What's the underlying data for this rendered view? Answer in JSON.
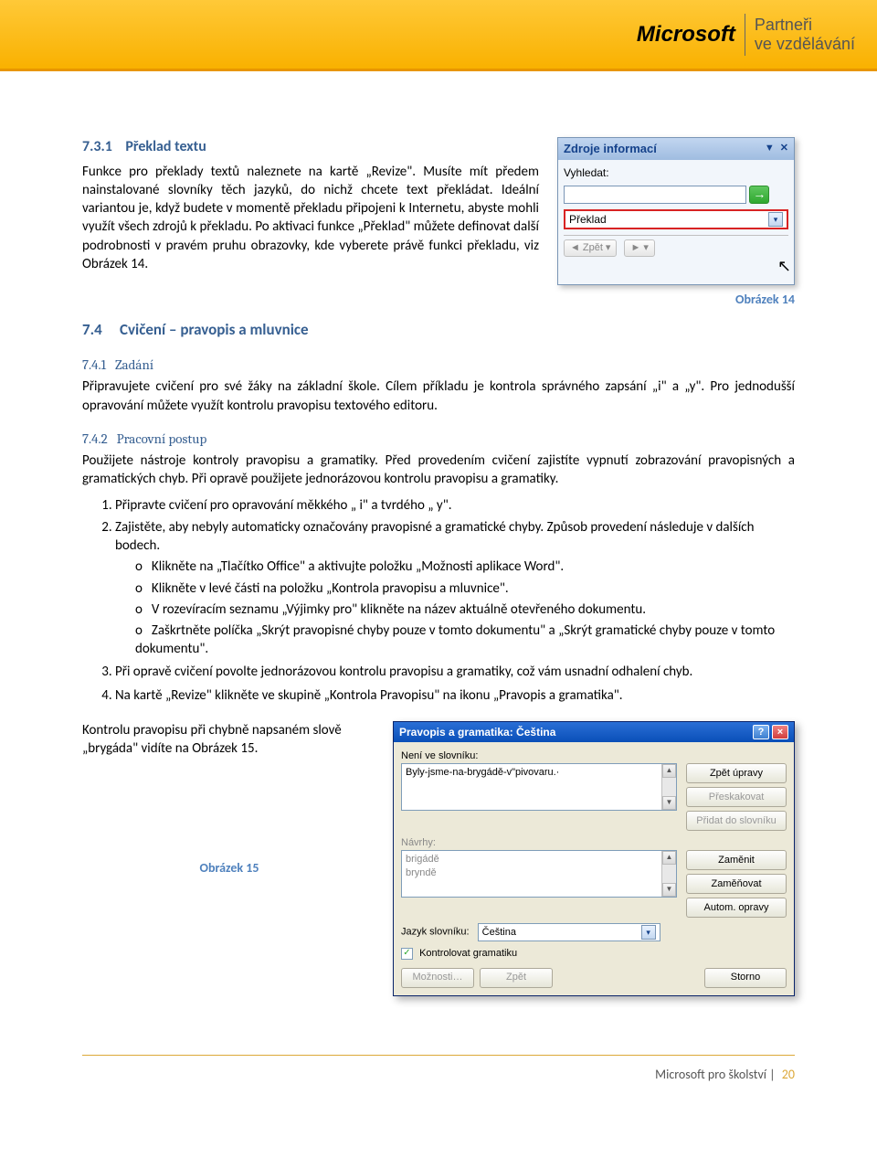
{
  "header": {
    "logo": "Microsoft",
    "partner_line1": "Partneři",
    "partner_line2": "ve vzdělávání"
  },
  "s731": {
    "number": "7.3.1",
    "title": "Překlad textu",
    "para": "Funkce pro překlady textů naleznete na kartě „Revize\". Musíte mít předem nainstalované slovníky těch jazyků, do nichž chcete text překládat. Ideální variantou je, když budete v momentě překladu připojeni k Internetu, abyste mohli využít všech zdrojů k překladu. Po aktivaci funkce „Překlad\" můžete definovat další podrobnosti v pravém pruhu obrazovky, kde vyberete právě funkci překladu, viz Obrázek 14."
  },
  "pane": {
    "title": "Zdroje informací",
    "search_label": "Vyhledat:",
    "select_value": "Překlad",
    "back": "Zpět"
  },
  "caption14": "Obrázek 14",
  "s74": {
    "number": "7.4",
    "title": "Cvičení – pravopis a mluvnice"
  },
  "s741": {
    "number": "7.4.1",
    "title": "Zadání",
    "para": "Připravujete cvičení pro své žáky na základní škole. Cílem příkladu je kontrola správného zapsání „i\" a „y\". Pro jednodušší opravování můžete využít kontrolu pravopisu textového editoru."
  },
  "s742": {
    "number": "7.4.2",
    "title": "Pracovní postup",
    "para": "Použijete nástroje kontroly pravopisu a gramatiky. Před provedením cvičení zajistíte vypnutí zobrazování pravopisných a gramatických chyb. Při opravě použijete jednorázovou kontrolu pravopisu a gramatiky.",
    "list": {
      "i1": "Připravte cvičení pro opravování měkkého „ i\" a tvrdého „ y\".",
      "i2": "Zajistěte, aby nebyly automaticky označovány pravopisné a gramatické chyby. Způsob provedení následuje v dalších bodech.",
      "i2a": "Klikněte na „Tlačítko Office\" a aktivujte položku „Možnosti aplikace Word\".",
      "i2b": "Klikněte v levé části na položku „Kontrola pravopisu a mluvnice\".",
      "i2c": "V rozevíracím seznamu „Výjimky pro\" klikněte na název aktuálně otevřeného dokumentu.",
      "i2d": "Zaškrtněte políčka „Skrýt pravopisné chyby pouze v tomto dokumentu\" a „Skrýt gramatické chyby pouze v tomto dokumentu\".",
      "i3": "Při opravě cvičení povolte jednorázovou kontrolu pravopisu a gramatiky, což vám usnadní odhalení chyb.",
      "i4": "Na kartě „Revize\" klikněte ve skupině „Kontrola Pravopisu\" na ikonu „Pravopis a gramatika\"."
    },
    "tail": "Kontrolu pravopisu při chybně napsaném slově „brygáda\" vidíte na Obrázek 15."
  },
  "dialog": {
    "title": "Pravopis a gramatika: Čeština",
    "label_notindict": "Není ve slovníku:",
    "sentence": "Byly-jsme-na-brygádě-v\"pivovaru.·",
    "label_suggest": "Návrhy:",
    "sugg1": "brigádě",
    "sugg2": "bryndě",
    "btn_zpet_upravy": "Zpět úpravy",
    "btn_preskakovat": "Přeskakovat",
    "btn_pridat": "Přidat do slovníku",
    "btn_zamenit": "Zaměnit",
    "btn_zamenovat": "Zaměňovat",
    "btn_autom": "Autom. opravy",
    "label_lang": "Jazyk slovníku:",
    "lang_value": "Čeština",
    "check_grammar": "Kontrolovat gramatiku",
    "btn_moznosti": "Možnosti…",
    "btn_zpet": "Zpět",
    "btn_storno": "Storno"
  },
  "caption15": "Obrázek 15",
  "footer": {
    "text": "Microsoft pro školství",
    "page": "20"
  }
}
